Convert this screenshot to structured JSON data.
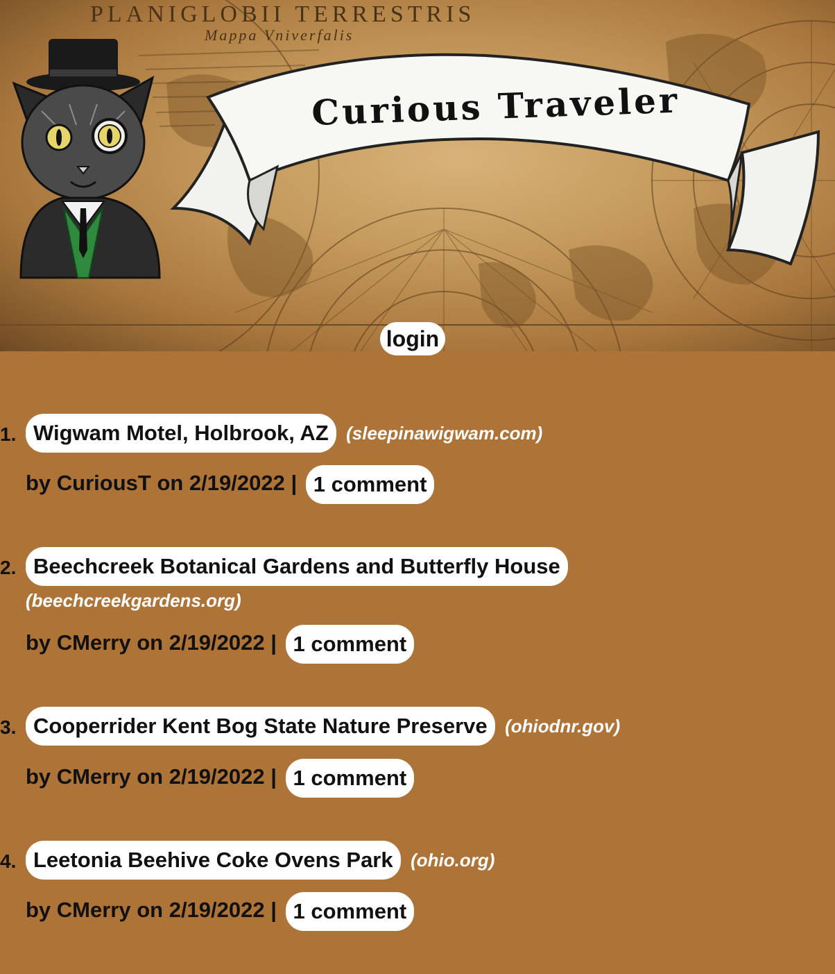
{
  "header": {
    "map_title": "PLANIGLOBII TERRESTRIS",
    "map_subtitle": "Mappa Vniverfalis",
    "site_name": "Curious Traveler",
    "login_label": "login"
  },
  "posts": [
    {
      "number": "1.",
      "title": "Wigwam Motel, Holbrook, AZ",
      "domain": "(sleepinawigwam.com)",
      "meta": "by CuriousT on 2/19/2022 |",
      "comments": "1 comment"
    },
    {
      "number": "2.",
      "title": "Beechcreek Botanical Gardens and Butterfly House",
      "domain": "(beechcreekgardens.org)",
      "meta": "by CMerry on 2/19/2022 |",
      "comments": "1 comment"
    },
    {
      "number": "3.",
      "title": "Cooperrider Kent Bog State Nature Preserve",
      "domain": "(ohiodnr.gov)",
      "meta": "by CMerry on 2/19/2022 |",
      "comments": "1 comment"
    },
    {
      "number": "4.",
      "title": "Leetonia Beehive Coke Ovens Park",
      "domain": "(ohio.org)",
      "meta": "by CMerry on 2/19/2022 |",
      "comments": "1 comment"
    }
  ],
  "colors": {
    "page_background": "#ad7337",
    "pill_background": "#ffffff",
    "domain_text": "#ffffff",
    "body_text": "#111111",
    "cat_vest": "#2f8a3e"
  },
  "icons": {
    "mascot": "cat-in-top-hat-illustration",
    "banner": "ribbon-banner",
    "background": "antique-world-map"
  }
}
